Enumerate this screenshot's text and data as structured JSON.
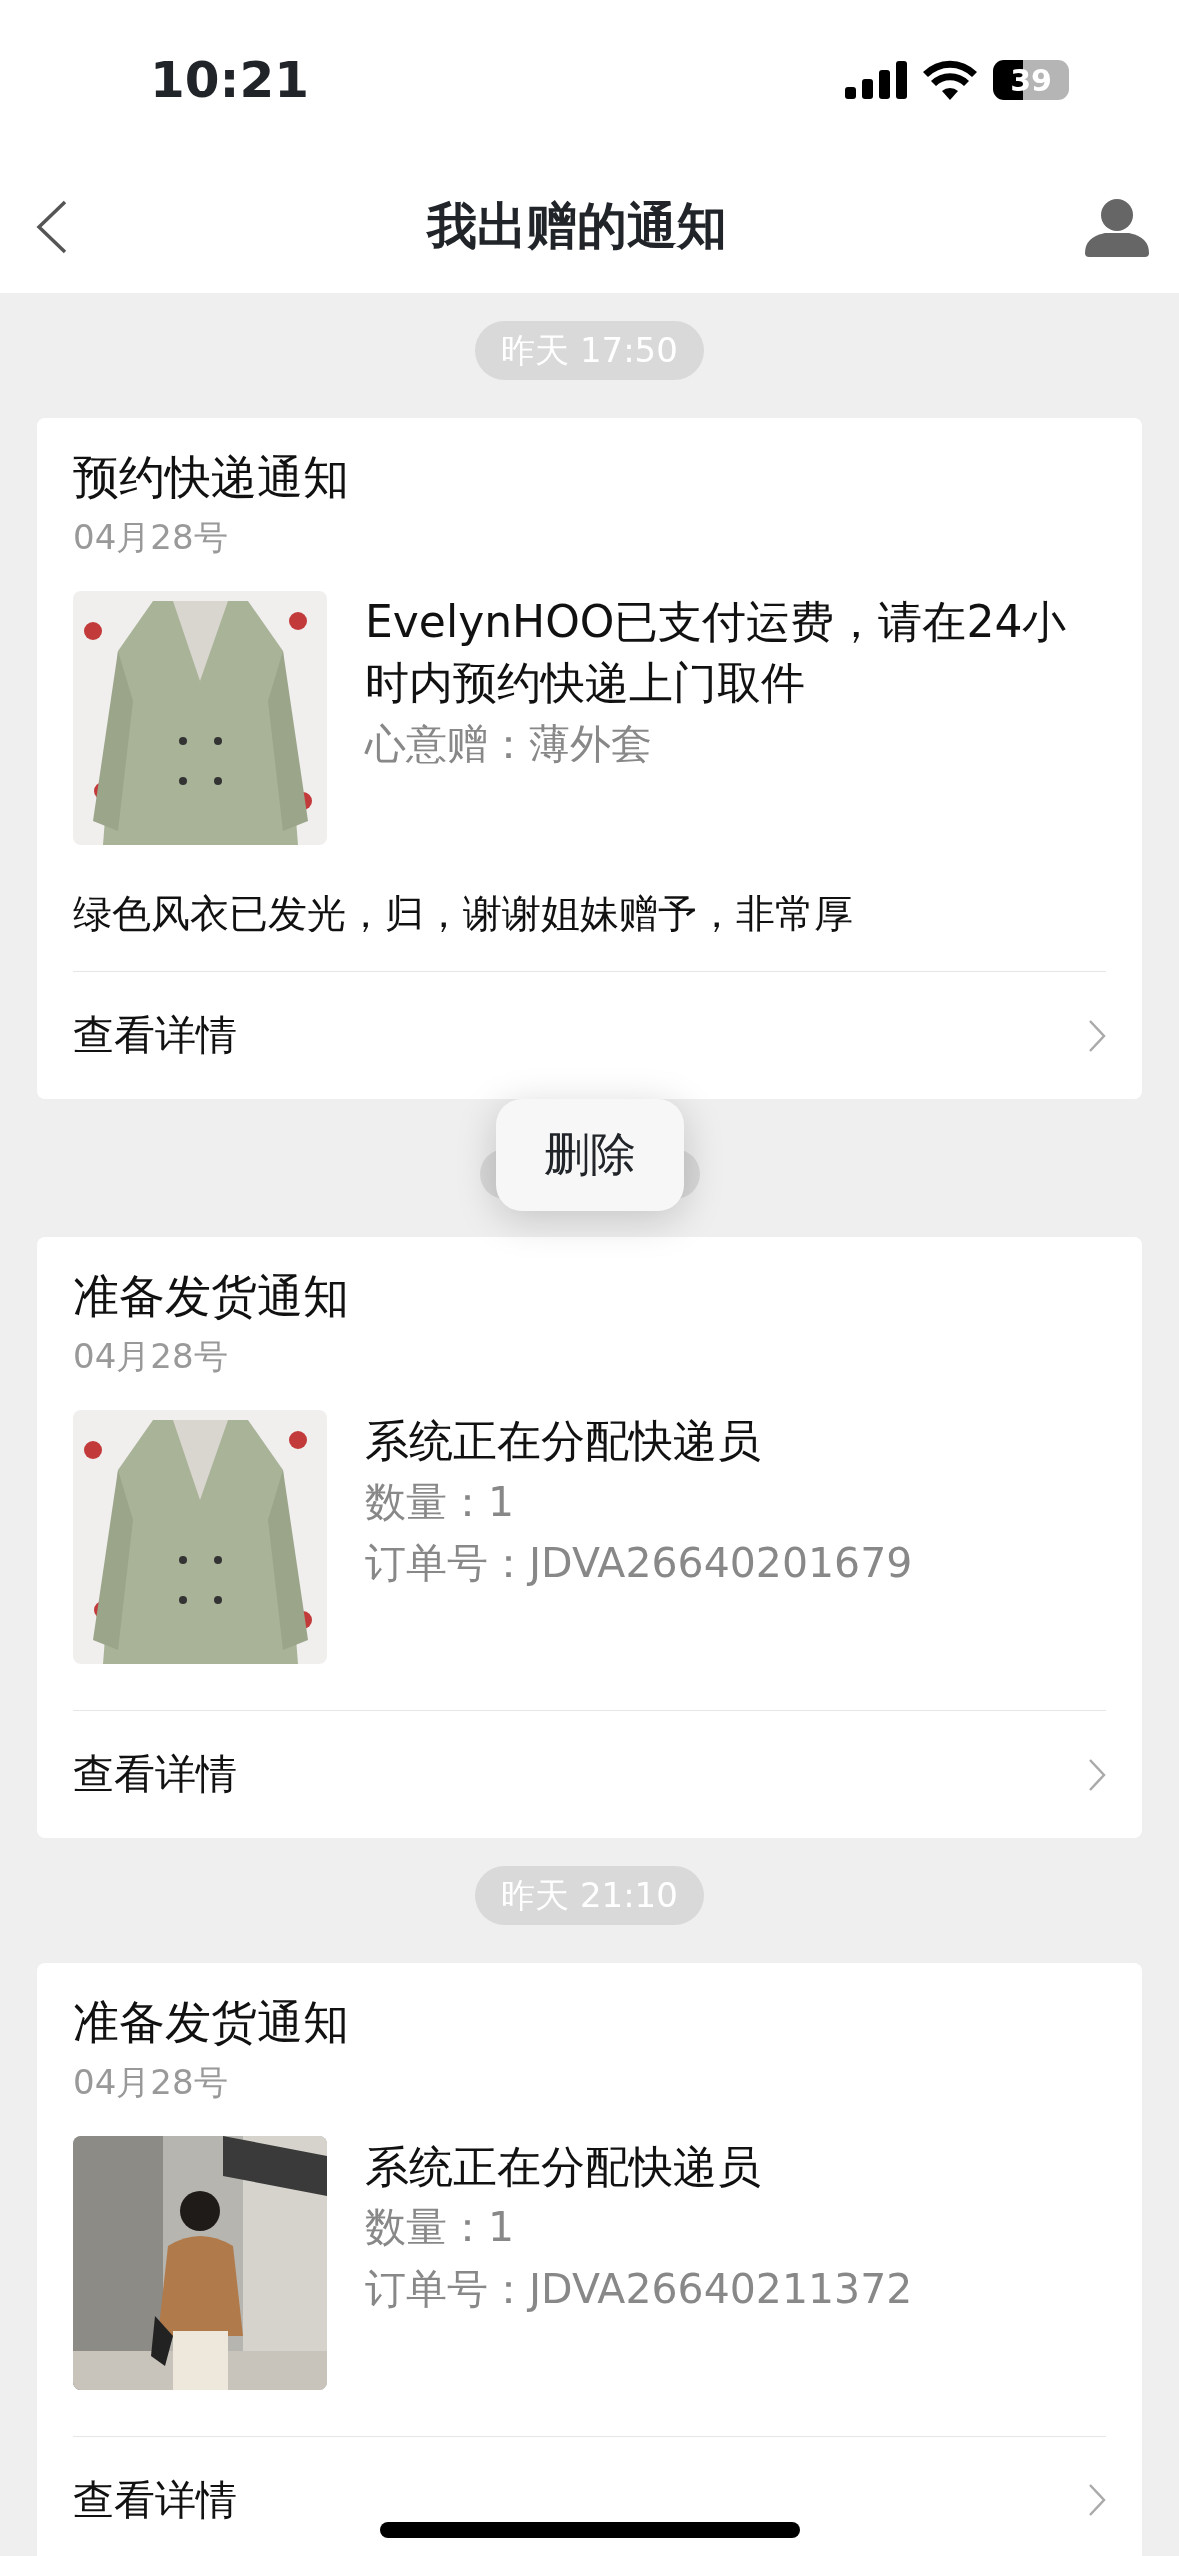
{
  "status_bar": {
    "time": "10:21",
    "battery": "39"
  },
  "nav": {
    "title": "我出赠的通知"
  },
  "feed": [
    {
      "kind": "time",
      "text": "昨天 17:50"
    },
    {
      "kind": "card",
      "title": "预约快递通知",
      "date": "04月28号",
      "lines": [
        {
          "kind": "main",
          "text": "EvelynHOO已支付运费，请在24小时内预约快递上门取件"
        },
        {
          "kind": "sub",
          "text": "心意赠：薄外套"
        }
      ],
      "note": "绿色风衣已发光，归，谢谢姐妹赠予，非常厚",
      "link": "查看详情"
    },
    {
      "kind": "time_with_popup",
      "popup": "删除"
    },
    {
      "kind": "card",
      "title": "准备发货通知",
      "date": "04月28号",
      "lines": [
        {
          "kind": "main",
          "text": "系统正在分配快递员"
        },
        {
          "kind": "sub",
          "text": "数量：1"
        },
        {
          "kind": "sub",
          "text": "订单号：JDVA26640201679"
        }
      ],
      "link": "查看详情"
    },
    {
      "kind": "time",
      "text": "昨天 21:10"
    },
    {
      "kind": "card",
      "title": "准备发货通知",
      "date": "04月28号",
      "lines": [
        {
          "kind": "main",
          "text": "系统正在分配快递员"
        },
        {
          "kind": "sub",
          "text": "数量：1"
        },
        {
          "kind": "sub",
          "text": "订单号：JDVA26640211372"
        }
      ],
      "link": "查看详情"
    }
  ]
}
